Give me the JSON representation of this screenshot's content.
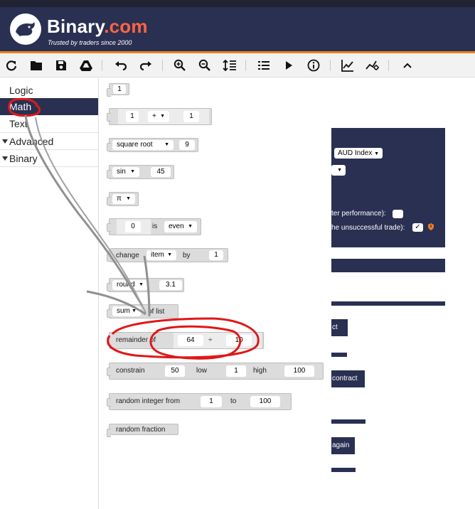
{
  "header": {
    "brand_name": "Binary",
    "brand_tld": ".com",
    "tagline": "Trusted by traders since 2000",
    "brand_accent_color": "#ff6444",
    "header_bg": "#2a3052",
    "toolbar_accent": "#e98024"
  },
  "toolbar": {
    "buttons": [
      "reload-icon",
      "open-folder-icon",
      "save-icon",
      "google-drive-icon",
      "undo-icon",
      "redo-icon",
      "zoom-in-icon",
      "zoom-out-icon",
      "rearrange-icon",
      "summary-icon",
      "run-icon",
      "info-icon",
      "chart-icon",
      "tradingview-icon",
      "collapse-icon"
    ]
  },
  "sidebar": {
    "categories": [
      {
        "label": "Logic",
        "selected": false
      },
      {
        "label": "Math",
        "selected": true
      },
      {
        "label": "Text",
        "selected": false
      },
      {
        "label": "Advanced",
        "folder": true
      },
      {
        "label": "Binary",
        "folder": true
      }
    ]
  },
  "workspace": {
    "market_select": "AUD Index",
    "label_performance": "ter performance):",
    "label_unsuccessful": "he unsuccessful trade):",
    "checkbox_mark": "✓",
    "btn_contract": "ct",
    "btn_contract2": "contract",
    "btn_again": "again"
  },
  "flyout": {
    "num_block": "1",
    "arith": {
      "a": "1",
      "op": "+",
      "b": "1"
    },
    "single": {
      "op": "square root",
      "value": "9"
    },
    "trig": {
      "op": "sin",
      "value": "45"
    },
    "constant": {
      "value": "π"
    },
    "property": {
      "value": "0",
      "label": "is",
      "prop": "even"
    },
    "change": {
      "label": "change",
      "var": "item",
      "by": "by",
      "value": "1"
    },
    "round": {
      "op": "round",
      "value": "3.1"
    },
    "on_list": {
      "op": "sum",
      "label": "of list"
    },
    "modulo": {
      "label": "remainder of",
      "a": "64",
      "op": "÷",
      "b": "10"
    },
    "constrain": {
      "label": "constrain",
      "value": "50",
      "low_label": "low",
      "low": "1",
      "high_label": "high",
      "high": "100"
    },
    "random_int": {
      "label": "random integer from",
      "from": "1",
      "to_label": "to",
      "to": "100"
    },
    "random_frac": {
      "label": "random fraction"
    }
  }
}
